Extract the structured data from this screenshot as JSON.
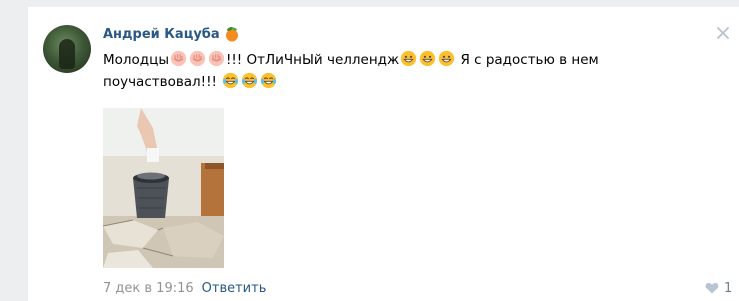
{
  "comment": {
    "author": "Андрей Кацуба",
    "author_badge_icon": "tangerine-icon",
    "text_line1_a": "Молодцы",
    "text_line1_b": "!!! ОтЛиЧнЫй челлендж",
    "text_line1_c": " Я с радостью в нем",
    "text_line2": "поучаствовал!!! ",
    "emoji_clap": "palms-up-icon",
    "emoji_grin": "grinning-face-icon",
    "emoji_laugh": "tears-of-joy-icon",
    "date": "7 дек в 19:16",
    "reply_label": "Ответить",
    "likes_count": "1"
  },
  "colors": {
    "link": "#2a5885",
    "muted": "#939393",
    "background": "#edeef0",
    "card": "#ffffff"
  }
}
